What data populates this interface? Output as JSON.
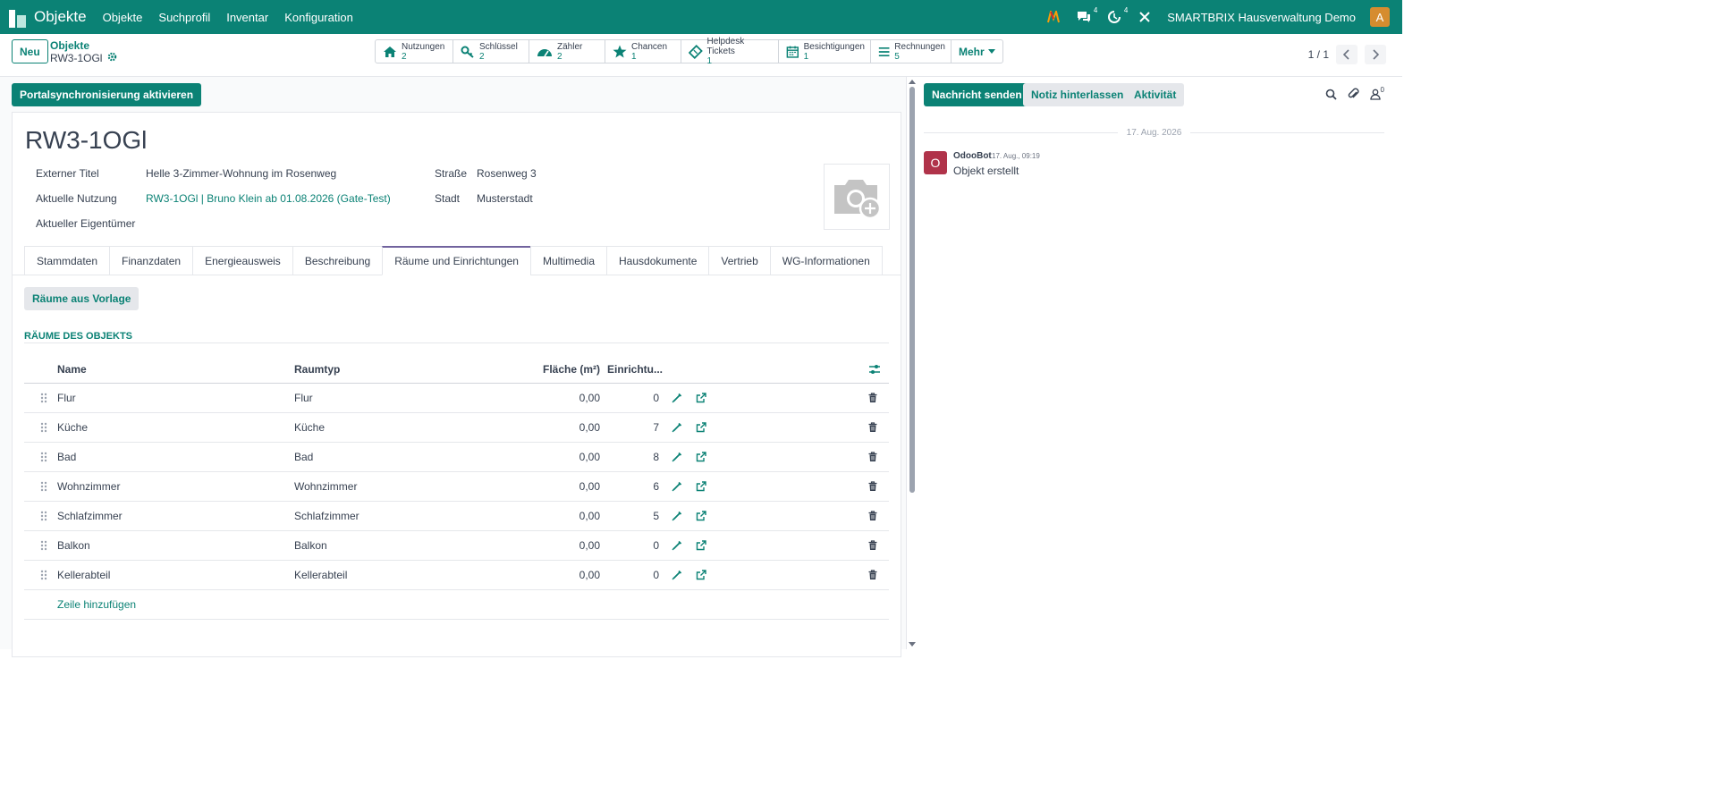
{
  "topbar": {
    "app_title": "Objekte",
    "menu": [
      "Objekte",
      "Suchprofil",
      "Inventar",
      "Konfiguration"
    ],
    "messages_count": "4",
    "activities_count": "4",
    "company": "SMARTBRIX Hausverwaltung Demo",
    "avatar_letter": "A",
    "accent": "#0b8275"
  },
  "control": {
    "new_label": "Neu",
    "breadcrumb_parent": "Objekte",
    "breadcrumb_current": "RW3-1OGl",
    "smart_buttons": [
      {
        "label": "Nutzungen",
        "count": "2",
        "icon": "home-icon"
      },
      {
        "label": "Schlüssel",
        "count": "2",
        "icon": "key-icon"
      },
      {
        "label": "Zähler",
        "count": "2",
        "icon": "gauge-icon"
      },
      {
        "label": "Chancen",
        "count": "1",
        "icon": "star-icon"
      },
      {
        "label": "Helpdesk Tickets",
        "count": "1",
        "icon": "ticket-icon"
      },
      {
        "label": "Besichtigungen",
        "count": "1",
        "icon": "calendar-icon"
      },
      {
        "label": "Rechnungen",
        "count": "5",
        "icon": "list-icon"
      }
    ],
    "more_label": "Mehr",
    "pager": "1 / 1"
  },
  "form": {
    "portal_button": "Portalsynchronisierung aktivieren",
    "title": "RW3-1OGl",
    "fields": {
      "external_title_label": "Externer Titel",
      "external_title_value": "Helle 3-Zimmer-Wohnung im Rosenweg",
      "current_use_label": "Aktuelle Nutzung",
      "current_use_value": "RW3-1OGl | Bruno Klein ab 01.08.2026 (Gate-Test)",
      "owner_label": "Aktueller Eigentümer",
      "street_label": "Straße",
      "street_value": "Rosenweg 3",
      "city_label": "Stadt",
      "city_value": "Musterstadt"
    },
    "tabs": [
      "Stammdaten",
      "Finanzdaten",
      "Energieausweis",
      "Beschreibung",
      "Räume und Einrichtungen",
      "Multimedia",
      "Hausdokumente",
      "Vertrieb",
      "WG-Informationen"
    ],
    "active_tab": "Räume und Einrichtungen",
    "template_button": "Räume aus Vorlage",
    "section_title": "RÄUME DES OBJEKTS",
    "table": {
      "headers": {
        "name": "Name",
        "type": "Raumtyp",
        "area": "Fläche (m²)",
        "einr": "Einrichtu..."
      },
      "rows": [
        {
          "name": "Flur",
          "type": "Flur",
          "area": "0,00",
          "einr": "0"
        },
        {
          "name": "Küche",
          "type": "Küche",
          "area": "0,00",
          "einr": "7"
        },
        {
          "name": "Bad",
          "type": "Bad",
          "area": "0,00",
          "einr": "8"
        },
        {
          "name": "Wohnzimmer",
          "type": "Wohnzimmer",
          "area": "0,00",
          "einr": "6"
        },
        {
          "name": "Schlafzimmer",
          "type": "Schlafzimmer",
          "area": "0,00",
          "einr": "5"
        },
        {
          "name": "Balkon",
          "type": "Balkon",
          "area": "0,00",
          "einr": "0"
        },
        {
          "name": "Kellerabteil",
          "type": "Kellerabteil",
          "area": "0,00",
          "einr": "0"
        }
      ],
      "add_line": "Zeile hinzufügen"
    }
  },
  "chatter": {
    "send_label": "Nachricht senden",
    "note_label": "Notiz hinterlassen",
    "activity_label": "Aktivität",
    "followers_count": "0",
    "date": "17. Aug. 2026",
    "message": {
      "avatar_letter": "O",
      "author": "OdooBot",
      "time": "17. Aug., 09:19",
      "body": "Objekt erstellt"
    }
  }
}
